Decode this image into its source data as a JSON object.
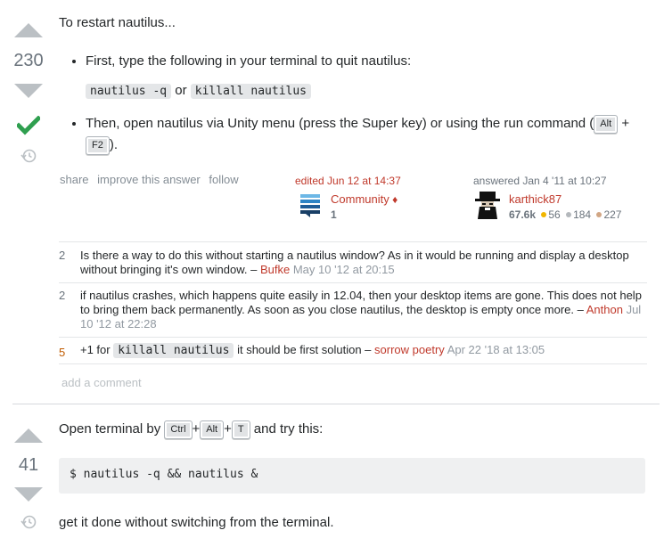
{
  "answer1": {
    "votes": "230",
    "intro": "To restart nautilus...",
    "bullet1": "First, type the following in your terminal to quit nautilus:",
    "code1": "nautilus -q",
    "or": "or",
    "code2": "killall nautilus",
    "bullet2_pre": "Then, open nautilus via Unity menu (press the Super key) or using the run command (",
    "key_alt": "Alt",
    "plus": "+",
    "key_f2": "F2",
    "bullet2_post": ").",
    "menu": {
      "share": "share",
      "improve": "improve this answer",
      "follow": "follow"
    },
    "edited": {
      "label": "edited Jun 12 at 14:37",
      "user": "Community",
      "diamond": "♦",
      "rep": "1"
    },
    "answered": {
      "label": "answered Jan 4 '11 at 10:27",
      "user": "karthick87",
      "rep": "67.6k",
      "gold": "56",
      "silver": "184",
      "bronze": "227"
    },
    "comments": [
      {
        "score": "2",
        "text": "Is there a way to do this without starting a nautilus window? As in it would be running and display a desktop without bringing it's own window. –",
        "user": "Bufke",
        "date": "May 10 '12 at 20:15"
      },
      {
        "score": "2",
        "text": "if nautilus crashes, which happens quite easily in 12.04, then your desktop items are gone. This does not help to bring them back permanently. As soon as you close nautilus, the desktop is empty once more. –",
        "user": "Anthon",
        "date": "Jul 10 '12 at 22:28"
      },
      {
        "score": "5",
        "text_pre": "+1 for",
        "code": "killall nautilus",
        "text_post": "it should be first solution –",
        "user": "sorrow poetry",
        "date": "Apr 22 '18 at 13:05"
      }
    ],
    "add_comment": "add a comment"
  },
  "answer2": {
    "votes": "41",
    "intro_pre": "Open terminal by",
    "key_ctrl": "Ctrl",
    "plus": "+",
    "key_alt": "Alt",
    "key_t": "T",
    "intro_post": "and try this:",
    "code": "$ nautilus -q && nautilus &",
    "outro": "get it done without switching from the terminal."
  },
  "colors": {
    "accent_link": "#c0392b",
    "accepted_check": "#2f9f4f",
    "arrow": "#bbc0c4",
    "muted": "#6a737c"
  }
}
